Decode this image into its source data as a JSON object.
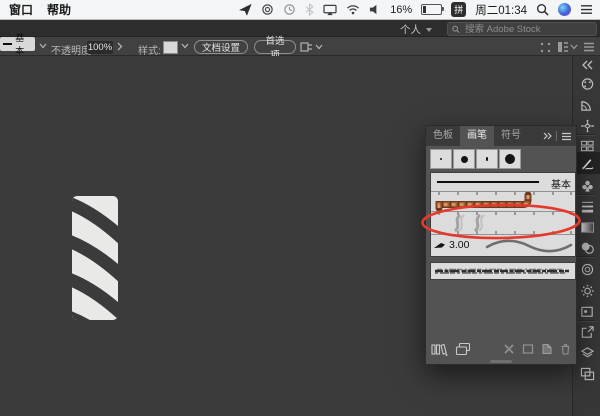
{
  "menubar": {
    "items": [
      "窗口",
      "帮助"
    ],
    "battery_pct": "16%",
    "ime": "拼",
    "clock": "周二01:34"
  },
  "appbar": {
    "workspace": "个人",
    "search_placeholder": "搜索 Adobe Stock"
  },
  "controlbar": {
    "stroke_style": "基本",
    "opacity_label": "不透明度:",
    "opacity_value": "100%",
    "style_label": "样式:",
    "doc_setup_label": "文档设置",
    "preferences_label": "首选项"
  },
  "brushes_panel": {
    "tabs": [
      "色板",
      "画笔",
      "符号"
    ],
    "active_tab": "画笔",
    "basic_brush_label": "基本",
    "art_brush_width": "3.00"
  },
  "colors": {
    "annotation_red": "#e5392e",
    "canvas_gray": "#3b3b3b",
    "panel_gray": "#535353",
    "brush_row_gray": "#dcdcdc",
    "rope_brown": "#8a4a32"
  }
}
